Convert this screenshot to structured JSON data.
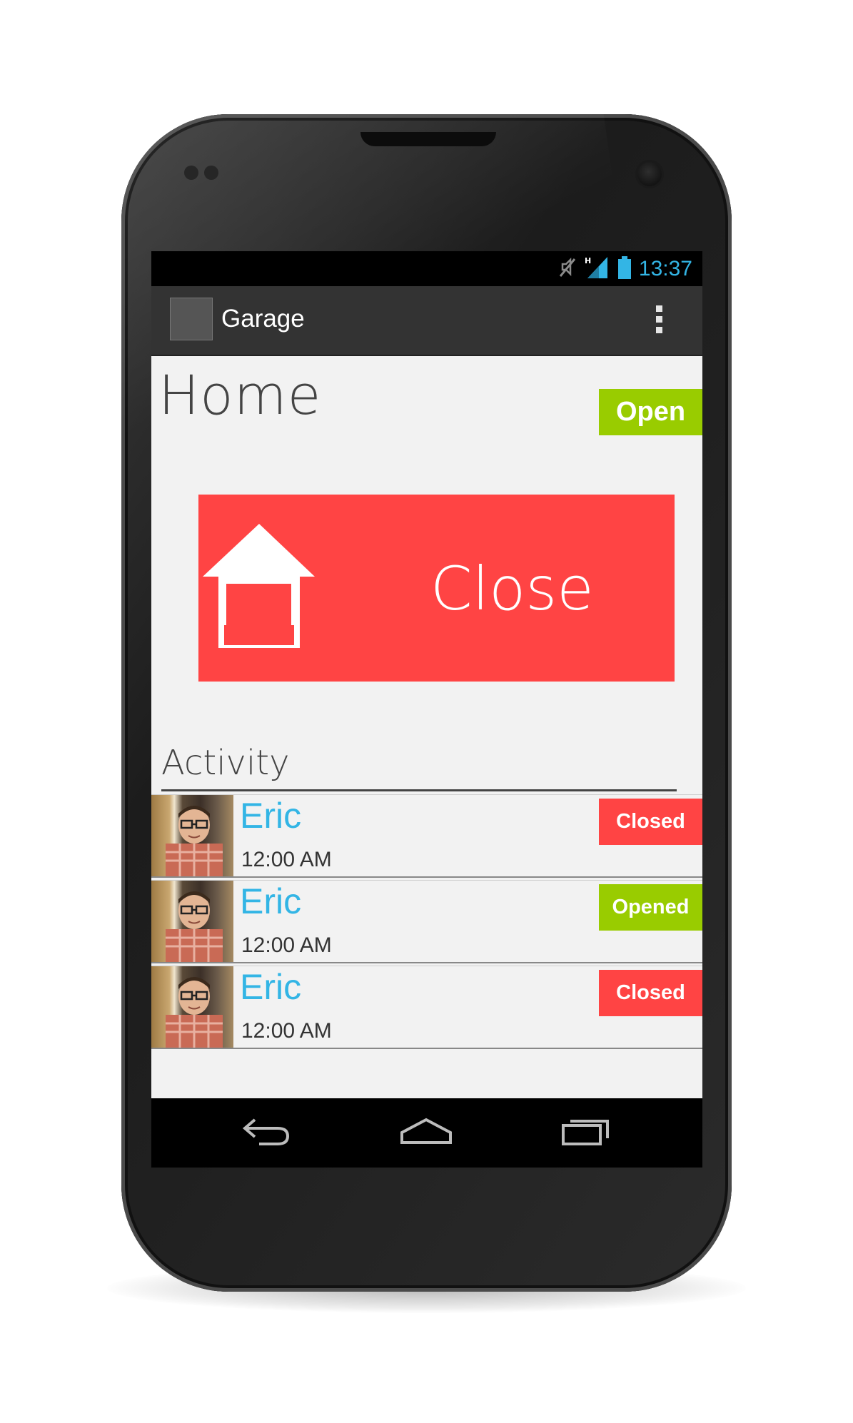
{
  "status_bar": {
    "time": "13:37",
    "icons": [
      "mute-icon",
      "signal-h-icon",
      "battery-icon"
    ],
    "accent_color": "#33b5e5"
  },
  "action_bar": {
    "title": "Garage",
    "menu_icon": "overflow-menu-icon"
  },
  "main": {
    "title": "Home",
    "state": {
      "label": "Open",
      "color": "#99cc00"
    },
    "action_button": {
      "label": "Close",
      "icon": "garage-icon",
      "color": "#ff4444"
    }
  },
  "activity": {
    "header": "Activity",
    "items": [
      {
        "name": "Eric",
        "time": "12:00 AM",
        "status": "Closed",
        "status_color": "#ff4444"
      },
      {
        "name": "Eric",
        "time": "12:00 AM",
        "status": "Opened",
        "status_color": "#99cc00"
      },
      {
        "name": "Eric",
        "time": "12:00 AM",
        "status": "Closed",
        "status_color": "#ff4444"
      }
    ]
  },
  "nav_bar": {
    "icons": [
      "back-icon",
      "home-icon",
      "recents-icon"
    ]
  }
}
